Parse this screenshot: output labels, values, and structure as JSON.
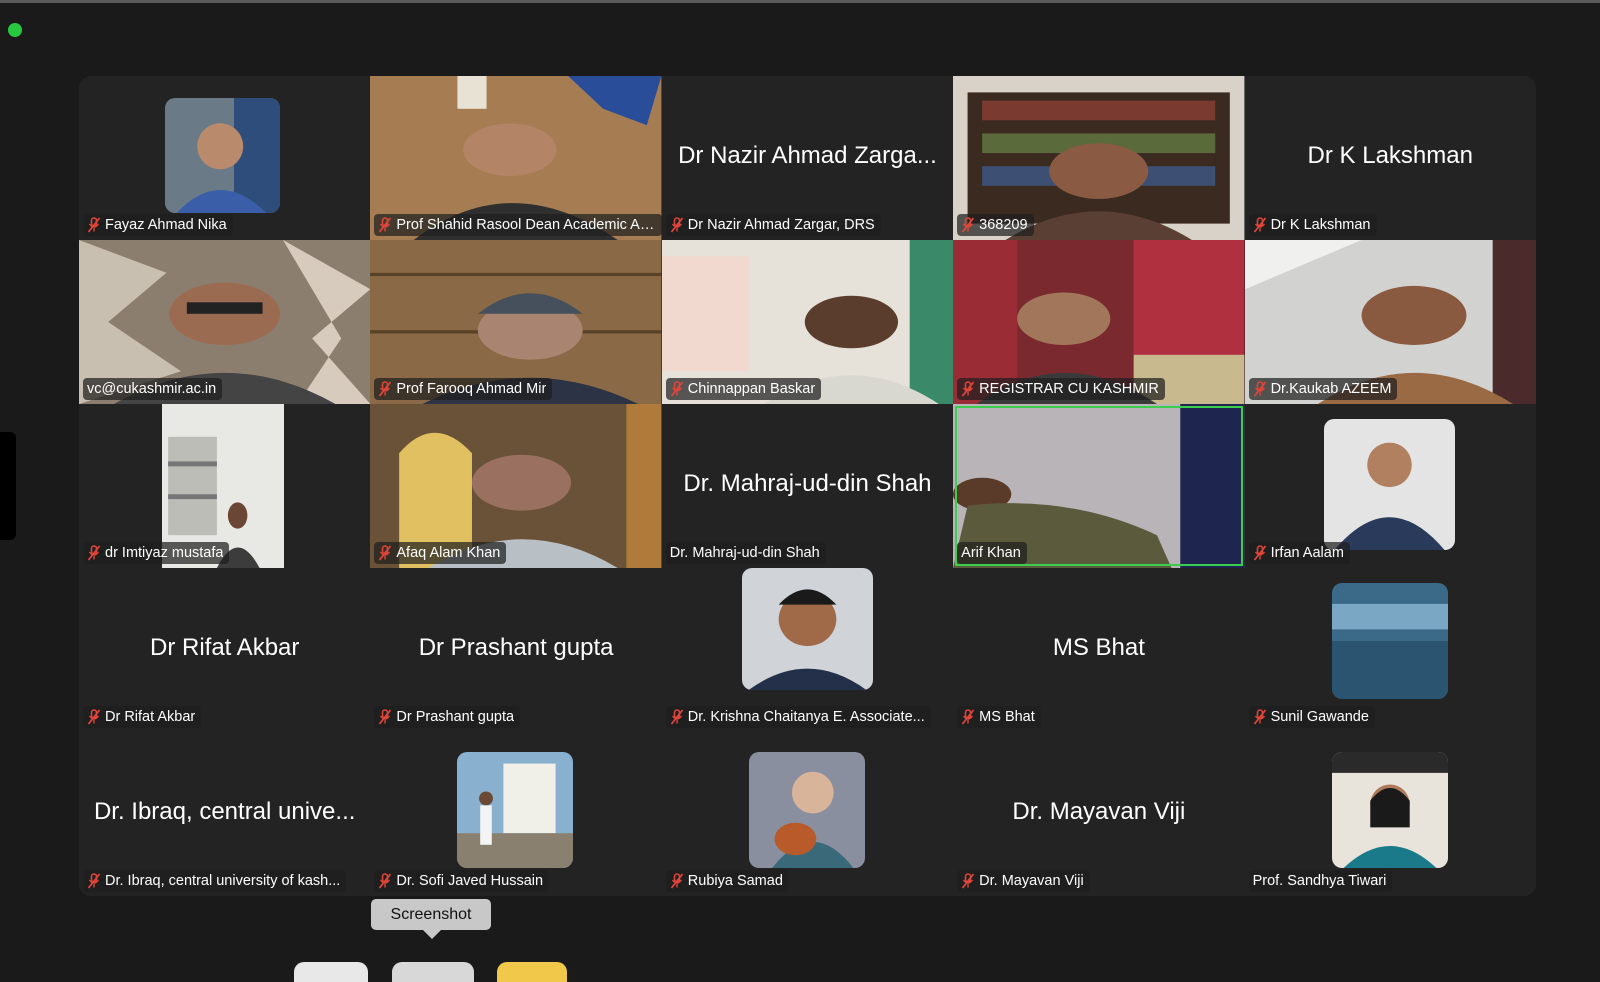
{
  "tooltip": "Screenshot",
  "colors": {
    "active_speaker": "#3ccf4e",
    "muted_icon": "#e0453a",
    "tile_bg": "#232323"
  },
  "participants": [
    {
      "label": "Fayaz Ahmad Nika",
      "muted": true,
      "display": "Fayaz Ahmad Nika"
    },
    {
      "label": "Prof Shahid Rasool Dean Academic Aff...",
      "muted": true,
      "display": ""
    },
    {
      "label": "Dr Nazir Ahmad Zargar, DRS",
      "muted": true,
      "display": "Dr Nazir Ahmad Zarga..."
    },
    {
      "label": "368209",
      "muted": true,
      "display": ""
    },
    {
      "label": "Dr K Lakshman",
      "muted": true,
      "display": "Dr K Lakshman"
    },
    {
      "label": "vc@cukashmir.ac.in",
      "muted": false,
      "display": ""
    },
    {
      "label": "Prof Farooq Ahmad Mir",
      "muted": true,
      "display": ""
    },
    {
      "label": "Chinnappan Baskar",
      "muted": true,
      "display": ""
    },
    {
      "label": "REGISTRAR CU KASHMIR",
      "muted": true,
      "display": ""
    },
    {
      "label": "Dr.Kaukab AZEEM",
      "muted": true,
      "display": ""
    },
    {
      "label": "dr Imtiyaz mustafa",
      "muted": true,
      "display": ""
    },
    {
      "label": "Afaq Alam Khan",
      "muted": true,
      "display": ""
    },
    {
      "label": "Dr. Mahraj-ud-din Shah",
      "muted": false,
      "display": "Dr. Mahraj-ud-din Shah"
    },
    {
      "label": "Arif Khan",
      "muted": false,
      "display": ""
    },
    {
      "label": "Irfan Aalam",
      "muted": true,
      "display": ""
    },
    {
      "label": "Dr Rifat Akbar",
      "muted": true,
      "display": "Dr Rifat Akbar"
    },
    {
      "label": "Dr Prashant gupta",
      "muted": true,
      "display": "Dr Prashant gupta"
    },
    {
      "label": "Dr. Krishna Chaitanya E. Associate...",
      "muted": true,
      "display": ""
    },
    {
      "label": "MS Bhat",
      "muted": true,
      "display": "MS Bhat"
    },
    {
      "label": "Sunil Gawande",
      "muted": true,
      "display": ""
    },
    {
      "label": "Dr. Ibraq, central university of kash...",
      "muted": true,
      "display": "Dr. Ibraq, central unive..."
    },
    {
      "label": "Dr. Sofi Javed Hussain",
      "muted": true,
      "display": ""
    },
    {
      "label": "Rubiya Samad",
      "muted": true,
      "display": ""
    },
    {
      "label": "Dr. Mayavan Viji",
      "muted": true,
      "display": "Dr. Mayavan Viji"
    },
    {
      "label": "Prof. Sandhya Tiwari",
      "muted": false,
      "display": ""
    }
  ]
}
